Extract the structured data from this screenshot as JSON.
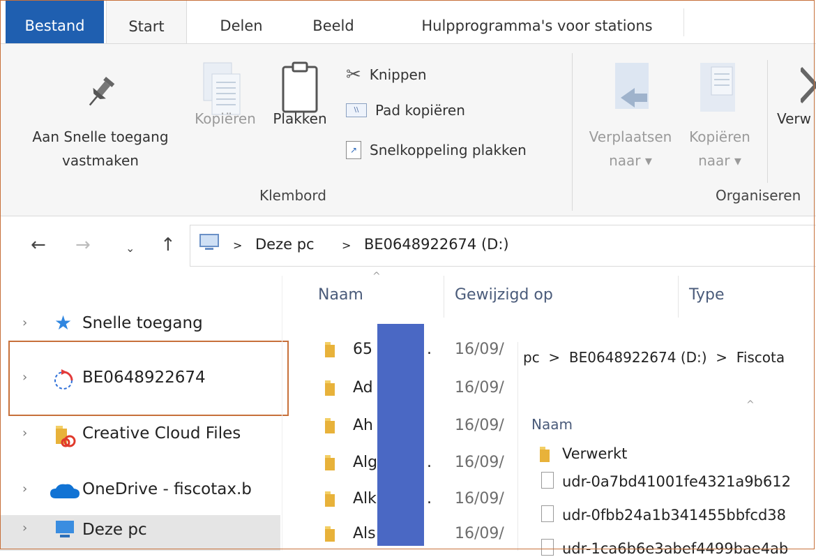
{
  "tabs": {
    "file": "Bestand",
    "start": "Start",
    "share": "Delen",
    "view": "Beeld",
    "drive_tools": "Hulpprogramma's voor stations"
  },
  "ribbon": {
    "pin_line1": "Aan Snelle toegang",
    "pin_line2": "vastmaken",
    "copy": "Kopiëren",
    "paste": "Plakken",
    "cut": "Knippen",
    "copy_path": "Pad kopiëren",
    "paste_shortcut": "Snelkoppeling plakken",
    "clipboard_group": "Klembord",
    "move_to_line1": "Verplaatsen",
    "move_to_line2": "naar ▾",
    "copy_to_line1": "Kopiëren",
    "copy_to_line2": "naar ▾",
    "delete_partial": "Verw",
    "organize_group": "Organiseren"
  },
  "address": {
    "crumb_pc": "Deze pc",
    "crumb_drive": "BE0648922674 (D:)",
    "separator": ">"
  },
  "nav": [
    {
      "label": "Snelle toegang",
      "icon": "star-icon"
    },
    {
      "label": "BE0648922674",
      "icon": "sync-icon"
    },
    {
      "label": "Creative Cloud Files",
      "icon": "creative-cloud-folder-icon"
    },
    {
      "label": "OneDrive - fiscotax.b",
      "icon": "onedrive-cloud-icon"
    },
    {
      "label": "Deze pc",
      "icon": "computer-icon"
    }
  ],
  "columns": {
    "name": "Naam",
    "modified": "Gewijzigd op",
    "type": "Type"
  },
  "rows": [
    {
      "name": "65",
      "date": "16/09/",
      "trail": "."
    },
    {
      "name": "Ad",
      "date": "16/09/",
      "trail": ""
    },
    {
      "name": "Ah",
      "date": "16/09/",
      "trail": ""
    },
    {
      "name": "Alg",
      "date": "16/09/",
      "trail": "."
    },
    {
      "name": "Alk",
      "date": "16/09/",
      "trail": "."
    },
    {
      "name": "Als",
      "date": "16/09/",
      "trail": ""
    }
  ],
  "overlay": {
    "breadcrumb": "pc  >  BE0648922674 (D:)  >  Fiscota",
    "column_name": "Naam",
    "items": [
      {
        "name": "Verwerkt",
        "kind": "folder"
      },
      {
        "name": "udr-0a7bd41001fe4321a9b612",
        "kind": "file"
      },
      {
        "name": "udr-0fbb24a1b341455bbfcd38",
        "kind": "file"
      },
      {
        "name": "udr-1ca6b6e3abef4499bae4ab",
        "kind": "file"
      }
    ]
  },
  "colors": {
    "file_tab": "#1f5fb0",
    "highlight_border": "#c7703a",
    "redaction": "#4a68c4",
    "folder": "#e8b23a"
  }
}
